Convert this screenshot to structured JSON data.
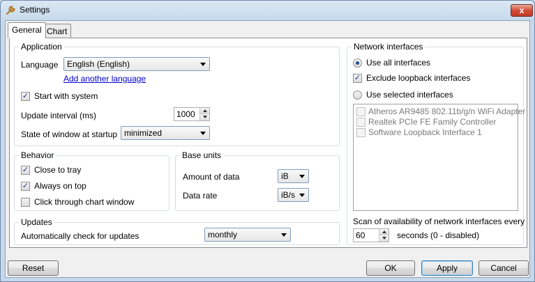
{
  "window": {
    "title": "Settings",
    "close_label": "x"
  },
  "tabs": [
    {
      "label": "General"
    },
    {
      "label": "Chart"
    }
  ],
  "application": {
    "group_label": "Application",
    "language_label": "Language",
    "language_value": "English (English)",
    "add_language_link": "Add another language",
    "start_with_system_label": "Start with system",
    "start_with_system_checked": "✓",
    "update_interval_label": "Update interval (ms)",
    "update_interval_value": "1000",
    "window_state_label": "State of window at startup",
    "window_state_value": "minimized"
  },
  "behavior": {
    "group_label": "Behavior",
    "close_to_tray_label": "Close to tray",
    "close_to_tray_checked": "✓",
    "always_on_top_label": "Always on top",
    "always_on_top_checked": "✓",
    "click_through_label": "Click through chart window",
    "click_through_checked": ""
  },
  "base_units": {
    "group_label": "Base units",
    "amount_label": "Amount of data",
    "amount_value": "iB",
    "rate_label": "Data rate",
    "rate_value": "iB/s"
  },
  "updates": {
    "group_label": "Updates",
    "auto_check_label": "Automatically check for updates",
    "auto_check_value": "monthly"
  },
  "network": {
    "group_label": "Network interfaces",
    "use_all_label": "Use all interfaces",
    "exclude_loopback_label": "Exclude loopback interfaces",
    "exclude_loopback_checked": "✓",
    "use_selected_label": "Use selected interfaces",
    "interfaces": [
      "Atheros AR9485 802.11b/g/n WiFi Adapter",
      "Realtek PCIe FE Family Controller",
      "Software Loopback Interface 1"
    ],
    "scan_label": "Scan of availability of network interfaces every",
    "scan_value": "60",
    "scan_suffix": "seconds (0 - disabled)"
  },
  "buttons": {
    "reset": "Reset",
    "ok": "OK",
    "apply": "Apply",
    "cancel": "Cancel"
  },
  "colors": {
    "title_bg": "#c6d8ea",
    "close_button": "#c33b25",
    "link": "#0000cc",
    "radio_dot": "#1f4fa0"
  }
}
